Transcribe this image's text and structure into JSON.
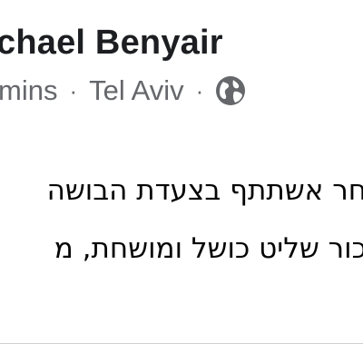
{
  "post": {
    "author": "chael Benyair",
    "time": "mins",
    "separator": "·",
    "location": "Tel Aviv",
    "privacy_icon": "globe-icon",
    "text_lines": [
      "חר אשתתף בצעדת הבושה",
      "כור שליט כושל ומושחת, מ"
    ]
  },
  "colors": {
    "name": "#1c1e21",
    "meta": "#65676b",
    "body": "#050505",
    "divider": "#ced0d4"
  }
}
